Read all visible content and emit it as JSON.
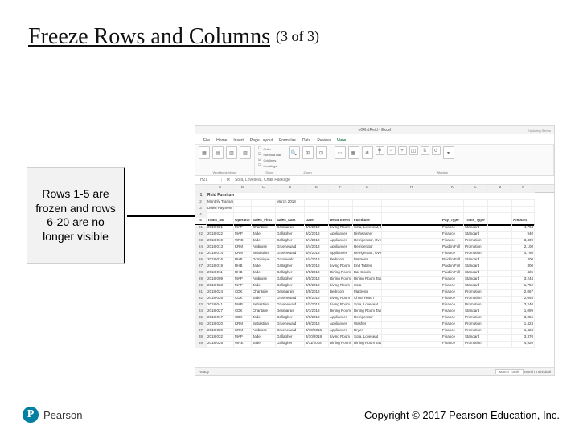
{
  "title_main": "Freeze Rows and Columns",
  "title_paren": "(3 of 3)",
  "callout_text": "Rows 1-5 are frozen and rows 6-20 are no longer visible",
  "screenshot": {
    "app_title": "e04h1Reid - Excel",
    "signin": "Exploring Series",
    "tabs": [
      "File",
      "Home",
      "Insert",
      "Page Layout",
      "Formulas",
      "Data",
      "Review",
      "View"
    ],
    "active_tab": "View",
    "ribbon": {
      "wbviews_label": "Workbook Views",
      "show_label": "Show",
      "zoom_label": "Zoom",
      "window_label": "Window",
      "show_checks": [
        "Ruler",
        "Formula Bar",
        "Gridlines",
        "Headings"
      ],
      "window_btns": [
        "New Window",
        "Arrange All",
        "Freeze Panes",
        "Split",
        "Hide",
        "Unhide",
        "View Side by Side",
        "Synchronous Scrolling",
        "Reset Window Position",
        "Switch Windows"
      ]
    },
    "fx_cell": "H21",
    "fx_formula": "Sofa, Loveseat, Chair Package",
    "cols": [
      "",
      "A",
      "B",
      "C",
      "D",
      "E",
      "F",
      "G",
      "H",
      "",
      "K",
      "L",
      "M",
      "N"
    ],
    "title_row": "Reid Furniture Store",
    "subtitle_row": "Monthly Transactions:",
    "month": "March 2018",
    "down_pay": "Down Payment Requirement:",
    "headers": [
      "",
      "Trans_No",
      "Operator",
      "Sales_First",
      "Sales_Last",
      "Date",
      "Department",
      "Furniture",
      "",
      "Pay_Type",
      "Trans_Type",
      "",
      "Amount"
    ],
    "rows": [
      {
        "n": 21,
        "t": "2018-021",
        "o": "MAP",
        "f": "Chantalle",
        "l": "Desmarais",
        "d": "3/1/2018",
        "dep": "Living Room",
        "fur": "Sofa, Loveseat, Chair Package",
        "pt": "Finance",
        "tt": "Standard",
        "amt": "4,794"
      },
      {
        "n": 22,
        "t": "2018-022",
        "o": "MAP",
        "f": "Jade",
        "l": "Gallagher",
        "d": "3/2/2018",
        "dep": "Appliances",
        "fur": "Dishwasher",
        "pt": "Finance",
        "tt": "Standard",
        "amt": "940"
      },
      {
        "n": 23,
        "t": "2018-010",
        "o": "WRE",
        "f": "Jade",
        "l": "Gallagher",
        "d": "3/4/2018",
        "dep": "Appliances",
        "fur": "Refrigerator, Oven, Microwave Combo",
        "pt": "Finance",
        "tt": "Promotion",
        "amt": "3,400"
      },
      {
        "n": 24,
        "t": "2018-013",
        "o": "KRM",
        "f": "Ambrose",
        "l": "Gruenewald",
        "d": "3/4/2018",
        "dep": "Appliances",
        "fur": "Refrigerator",
        "pt": "Paid in Full",
        "tt": "Promotion",
        "amt": "2,100"
      },
      {
        "n": 25,
        "t": "2018-014",
        "o": "KRM",
        "f": "Sebastian",
        "l": "Gruenewald",
        "d": "3/4/2018",
        "dep": "Appliances",
        "fur": "Refrigerator, Oven, Microwave Combo",
        "pt": "Finance",
        "tt": "Promotion",
        "amt": "4,750"
      },
      {
        "n": 26,
        "t": "2018-016",
        "o": "RHB",
        "f": "Dominique",
        "l": "Grunewald",
        "d": "3/4/2018",
        "dep": "Bedroom",
        "fur": "Mattress",
        "pt": "Paid in Full",
        "tt": "Standard",
        "amt": "400"
      },
      {
        "n": 27,
        "t": "2018-019",
        "o": "RHB",
        "f": "Jade",
        "l": "Gallagher",
        "d": "3/5/2018",
        "dep": "Living Room",
        "fur": "End Tables",
        "pt": "Paid in Full",
        "tt": "Standard",
        "amt": "300"
      },
      {
        "n": 28,
        "t": "2018-011",
        "o": "RHB",
        "f": "Jade",
        "l": "Gallagher",
        "d": "3/5/2018",
        "dep": "Dining Room",
        "fur": "Bar Stools",
        "pt": "Paid in Full",
        "tt": "Standard",
        "amt": "425"
      },
      {
        "n": 29,
        "t": "2018-009",
        "o": "MAP",
        "f": "Ambrose",
        "l": "Gallagher",
        "d": "3/5/2018",
        "dep": "Dining Room",
        "fur": "Dining Room Table and Chairs",
        "pt": "Finance",
        "tt": "Standard",
        "amt": "3,244"
      },
      {
        "n": 30,
        "t": "2018-023",
        "o": "MAP",
        "f": "Jade",
        "l": "Gallagher",
        "d": "3/5/2018",
        "dep": "Living Room",
        "fur": "Sofa",
        "pt": "Finance",
        "tt": "Standard",
        "amt": "1,752"
      },
      {
        "n": 31,
        "t": "2018-024",
        "o": "CDK",
        "f": "Chantalle",
        "l": "Desmarais",
        "d": "3/5/2018",
        "dep": "Bedroom",
        "fur": "Mattress",
        "pt": "Finance",
        "tt": "Promotion",
        "amt": "2,067"
      },
      {
        "n": 32,
        "t": "2018-026",
        "o": "CDK",
        "f": "Jade",
        "l": "Gruenewald",
        "d": "3/6/2018",
        "dep": "Living Room",
        "fur": "China Hutch",
        "pt": "Finance",
        "tt": "Promotion",
        "amt": "2,093"
      },
      {
        "n": 33,
        "t": "2018-041",
        "o": "MAP",
        "f": "Sebastian",
        "l": "Gruenewald",
        "d": "3/7/2018",
        "dep": "Living Room",
        "fur": "Sofa, Loveseat",
        "pt": "Finance",
        "tt": "Promotion",
        "amt": "3,240"
      },
      {
        "n": 34,
        "t": "2018-027",
        "o": "CDK",
        "f": "Chantalle",
        "l": "Desmarais",
        "d": "3/7/2018",
        "dep": "Dining Room",
        "fur": "Dining Room Table and Chairs",
        "pt": "Finance",
        "tt": "Standard",
        "amt": "1,099"
      },
      {
        "n": 35,
        "t": "2018-017",
        "o": "CDK",
        "f": "Jade",
        "l": "Gallagher",
        "d": "3/8/2018",
        "dep": "Appliances",
        "fur": "Refrigerator",
        "pt": "Finance",
        "tt": "Promotion",
        "amt": "3,056"
      },
      {
        "n": 36,
        "t": "2018-020",
        "o": "KRM",
        "f": "Sebastian",
        "l": "Gruenewald",
        "d": "3/8/2018",
        "dep": "Appliances",
        "fur": "Washer",
        "pt": "Finance",
        "tt": "Promotion",
        "amt": "1,424"
      },
      {
        "n": 37,
        "t": "2018-029",
        "o": "KRM",
        "f": "Ambrose",
        "l": "Gruenewald",
        "d": "3/10/2018",
        "dep": "Appliances",
        "fur": "Dryer",
        "pt": "Finance",
        "tt": "Promotion",
        "amt": "1,424"
      },
      {
        "n": 38,
        "t": "2018-032",
        "o": "MAP",
        "f": "Jade",
        "l": "Gallagher",
        "d": "3/10/2018",
        "dep": "Living Room",
        "fur": "Sofa, Loveseat",
        "pt": "Finance",
        "tt": "Standard",
        "amt": "3,370"
      },
      {
        "n": 39,
        "t": "2018-025",
        "o": "WRE",
        "f": "Jade",
        "l": "Gallagher",
        "d": "3/11/2018",
        "dep": "Dining Room",
        "fur": "Dining Room Table and Chairs",
        "pt": "Finance",
        "tt": "Promotion",
        "amt": "4,920"
      }
    ],
    "sheet_tab": "March Totals",
    "next_tab": "March Individual",
    "status": "Ready"
  },
  "footer": "Copyright © 2017 Pearson Education, Inc.",
  "logo_text": "Pearson",
  "logo_p": "P"
}
